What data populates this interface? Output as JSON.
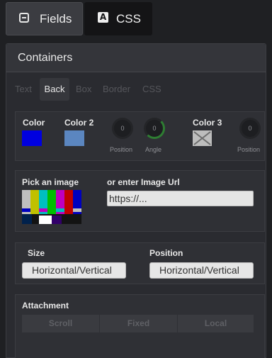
{
  "top_tabs": {
    "fields": "Fields",
    "css": "CSS"
  },
  "panel": {
    "title": "Containers"
  },
  "sub_tabs": [
    "Text",
    "Back",
    "Box",
    "Border",
    "CSS"
  ],
  "colors": {
    "color1": {
      "label": "Color",
      "value": "#0000e0"
    },
    "color2": {
      "label": "Color 2",
      "value": "#5b86c0"
    },
    "knob_position": {
      "value": "0",
      "label": "Position"
    },
    "knob_angle": {
      "value": "0",
      "label": "Angle"
    },
    "color3": {
      "label": "Color 3",
      "value": "transparent"
    },
    "knob_position2": {
      "value": "0",
      "label": "Position"
    }
  },
  "image": {
    "pick_label": "Pick an image",
    "url_label": "or enter Image Url",
    "url_value": "https://..."
  },
  "size": {
    "label": "Size",
    "value": "Horizontal/Vertical"
  },
  "position": {
    "label": "Position",
    "value": "Horizontal/Vertical"
  },
  "attachment": {
    "label": "Attachment",
    "options": [
      "Scroll",
      "Fixed",
      "Local"
    ]
  }
}
